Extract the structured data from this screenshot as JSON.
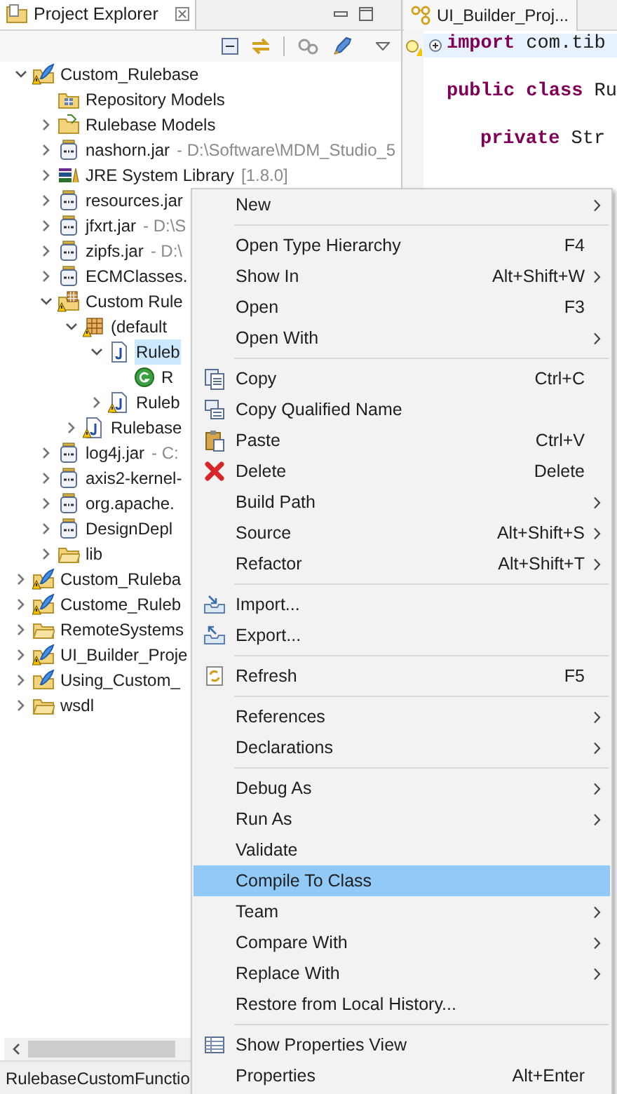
{
  "explorer": {
    "title": "Project Explorer",
    "tree": [
      {
        "label": "Custom_Rulebase",
        "kind": "project",
        "warning": true,
        "expanded": true,
        "selected": false,
        "children": [
          {
            "label": "Repository Models",
            "kind": "repository",
            "warning": false,
            "selected": false
          },
          {
            "label": "Rulebase Models",
            "kind": "models",
            "warning": false,
            "expanded": false,
            "selected": false
          },
          {
            "label": "nashorn.jar",
            "decoration": "- D:\\Software\\MDM_Studio_5",
            "kind": "jar",
            "warning": false,
            "expanded": false,
            "selected": false
          },
          {
            "label": "JRE System Library",
            "decoration": "[1.8.0]",
            "kind": "library",
            "warning": false,
            "expanded": false,
            "selected": false
          },
          {
            "label": "resources.jar",
            "kind": "jar",
            "warning": false,
            "expanded": false,
            "selected": false
          },
          {
            "label": "jfxrt.jar",
            "decoration": "- D:\\S",
            "kind": "jar",
            "warning": false,
            "expanded": false,
            "selected": false
          },
          {
            "label": "zipfs.jar",
            "decoration": "- D:\\",
            "kind": "jar",
            "warning": false,
            "expanded": false,
            "selected": false
          },
          {
            "label": "ECMClasses.",
            "kind": "jar",
            "warning": false,
            "expanded": false,
            "selected": false
          },
          {
            "label": "Custom Rule",
            "kind": "source",
            "warning": true,
            "expanded": true,
            "selected": false,
            "children": [
              {
                "label": "(default",
                "kind": "package",
                "warning": true,
                "expanded": true,
                "selected": false,
                "children": [
                  {
                    "label": "Ruleb",
                    "kind": "file",
                    "warning": false,
                    "expanded": true,
                    "selected": true,
                    "children": [
                      {
                        "label": "R",
                        "kind": "class",
                        "warning": false,
                        "selected": false
                      }
                    ]
                  },
                  {
                    "label": "Ruleb",
                    "kind": "file",
                    "warning": true,
                    "expanded": false,
                    "selected": false
                  }
                ]
              },
              {
                "label": "Rulebase",
                "kind": "file",
                "warning": true,
                "expanded": false,
                "selected": false
              }
            ]
          },
          {
            "label": "log4j.jar",
            "decoration": "- C:",
            "kind": "jar",
            "warning": false,
            "expanded": false,
            "selected": false
          },
          {
            "label": "axis2-kernel-",
            "kind": "jar",
            "warning": false,
            "expanded": false,
            "selected": false
          },
          {
            "label": "org.apache.",
            "kind": "jar",
            "warning": false,
            "expanded": false,
            "selected": false
          },
          {
            "label": "DesignDepl",
            "kind": "jar",
            "warning": false,
            "expanded": false,
            "selected": false
          },
          {
            "label": "lib",
            "kind": "folder",
            "warning": false,
            "expanded": false,
            "selected": false
          }
        ]
      },
      {
        "label": "Custom_Ruleba",
        "kind": "project",
        "warning": true,
        "expanded": false,
        "selected": false
      },
      {
        "label": "Custome_Ruleb",
        "kind": "project",
        "warning": true,
        "expanded": false,
        "selected": false
      },
      {
        "label": "RemoteSystems",
        "kind": "folder",
        "warning": false,
        "expanded": false,
        "selected": false
      },
      {
        "label": "UI_Builder_Proje",
        "kind": "project",
        "warning": true,
        "expanded": false,
        "selected": false
      },
      {
        "label": "Using_Custom_",
        "kind": "project",
        "warning": false,
        "expanded": false,
        "selected": false
      },
      {
        "label": "wsdl",
        "kind": "folder",
        "warning": false,
        "expanded": false,
        "selected": false
      }
    ],
    "status": "RulebaseCustomFunctio"
  },
  "editor": {
    "tab": "UI_Builder_Proj...",
    "lines": [
      {
        "text": "**import** com.tib",
        "folded": true,
        "warning": true
      },
      {
        "text": "**public class** Ru",
        "folded": false,
        "warning": false,
        "indent": false
      },
      {
        "text": "**private** Str",
        "folded": false,
        "warning": false,
        "indent": true
      }
    ]
  },
  "context_menu": [
    {
      "kind": "item",
      "label": "New",
      "submenu": true,
      "selected": false
    },
    {
      "kind": "separator"
    },
    {
      "kind": "item",
      "label": "Open Type Hierarchy",
      "shortcut": "F4",
      "submenu": false,
      "selected": false
    },
    {
      "kind": "item",
      "label": "Show In",
      "shortcut": "Alt+Shift+W",
      "submenu": true,
      "selected": false
    },
    {
      "kind": "item",
      "label": "Open",
      "shortcut": "F3",
      "submenu": false,
      "selected": false
    },
    {
      "kind": "item",
      "label": "Open With",
      "submenu": true,
      "selected": false
    },
    {
      "kind": "separator"
    },
    {
      "kind": "item",
      "label": "Copy",
      "shortcut": "Ctrl+C",
      "submenu": false,
      "selected": false
    },
    {
      "kind": "item",
      "label": "Copy Qualified Name",
      "submenu": false,
      "selected": false
    },
    {
      "kind": "item",
      "label": "Paste",
      "shortcut": "Ctrl+V",
      "submenu": false,
      "selected": false
    },
    {
      "kind": "item",
      "label": "Delete",
      "shortcut": "Delete",
      "submenu": false,
      "selected": false
    },
    {
      "kind": "item",
      "label": "Build Path",
      "submenu": true,
      "selected": false
    },
    {
      "kind": "item",
      "label": "Source",
      "shortcut": "Alt+Shift+S",
      "submenu": true,
      "selected": false
    },
    {
      "kind": "item",
      "label": "Refactor",
      "shortcut": "Alt+Shift+T",
      "submenu": true,
      "selected": false
    },
    {
      "kind": "separator"
    },
    {
      "kind": "item",
      "label": "Import...",
      "submenu": false,
      "selected": false
    },
    {
      "kind": "item",
      "label": "Export...",
      "submenu": false,
      "selected": false
    },
    {
      "kind": "separator"
    },
    {
      "kind": "item",
      "label": "Refresh",
      "shortcut": "F5",
      "submenu": false,
      "selected": false
    },
    {
      "kind": "separator"
    },
    {
      "kind": "item",
      "label": "References",
      "submenu": true,
      "selected": false
    },
    {
      "kind": "item",
      "label": "Declarations",
      "submenu": true,
      "selected": false
    },
    {
      "kind": "separator"
    },
    {
      "kind": "item",
      "label": "Debug As",
      "submenu": true,
      "selected": false
    },
    {
      "kind": "item",
      "label": "Run As",
      "submenu": true,
      "selected": false
    },
    {
      "kind": "item",
      "label": "Validate",
      "submenu": false,
      "selected": false
    },
    {
      "kind": "item",
      "label": "Compile To Class",
      "submenu": false,
      "selected": true
    },
    {
      "kind": "item",
      "label": "Team",
      "submenu": true,
      "selected": false
    },
    {
      "kind": "item",
      "label": "Compare With",
      "submenu": true,
      "selected": false
    },
    {
      "kind": "item",
      "label": "Replace With",
      "submenu": true,
      "selected": false
    },
    {
      "kind": "item",
      "label": "Restore from Local History...",
      "submenu": false,
      "selected": false
    },
    {
      "kind": "separator"
    },
    {
      "kind": "item",
      "label": "Show Properties View",
      "submenu": false,
      "selected": false
    },
    {
      "kind": "item",
      "label": "Properties",
      "shortcut": "Alt+Enter",
      "submenu": false,
      "selected": false
    }
  ]
}
